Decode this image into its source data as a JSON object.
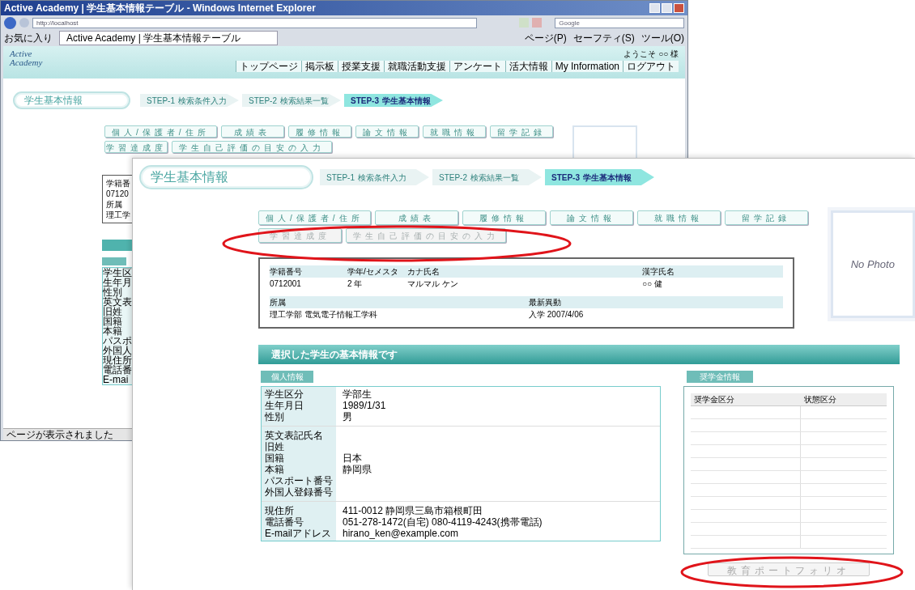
{
  "back_window": {
    "title": "Active Academy | 学生基本情報テーブル - Windows Internet Explorer",
    "address": "http://localhost",
    "search": "Google",
    "favorites": "お気に入り",
    "tab": "Active Academy | 学生基本情報テーブル",
    "toolbar": [
      "ページ(P)",
      "セーフティ(S)",
      "ツール(O)"
    ],
    "logo": "Active Academy",
    "welcome": "ようこそ ○○ 様",
    "nav": [
      "トップページ",
      "掲示板",
      "授業支援",
      "就職活動支援",
      "アンケート",
      "活大情報",
      "My Information",
      "ログアウト"
    ],
    "page_title": "学生基本情報",
    "steps": [
      {
        "step": "STEP-1",
        "label": "検索条件入力",
        "selected": false
      },
      {
        "step": "STEP-2",
        "label": "検索結果一覧",
        "selected": false
      },
      {
        "step": "STEP-3",
        "label": "学生基本情報",
        "selected": true
      }
    ],
    "tab_rows": [
      [
        {
          "label": "個人/保護者/住所",
          "disabled": false
        },
        {
          "label": "成績表",
          "disabled": false
        },
        {
          "label": "履修情報",
          "disabled": false
        },
        {
          "label": "論文情報",
          "disabled": false
        },
        {
          "label": "就職情報",
          "disabled": false
        },
        {
          "label": "留学記録",
          "disabled": false
        }
      ],
      [
        {
          "label": "学習達成度",
          "disabled": false
        },
        {
          "label": "学生自己評価の目安の入力",
          "disabled": false
        }
      ]
    ],
    "covered_texts": [
      "学籍番",
      "07120",
      "所属",
      "理工学"
    ],
    "covered_list": [
      "学生区",
      "生年月",
      "性別",
      "英文表",
      "旧姓",
      "国籍",
      "本籍",
      "パスポ",
      "外国人",
      "現住所",
      "電話番",
      "E-mai"
    ],
    "status": "ページが表示されました"
  },
  "front_panel": {
    "page_title": "学生基本情報",
    "steps": [
      {
        "step": "STEP-1",
        "label": "検索条件入力",
        "selected": false
      },
      {
        "step": "STEP-2",
        "label": "検索結果一覧",
        "selected": false
      },
      {
        "step": "STEP-3",
        "label": "学生基本情報",
        "selected": true
      }
    ],
    "tab_rows": [
      [
        {
          "label": "個人/保護者/住所",
          "disabled": false
        },
        {
          "label": "成績表",
          "disabled": false
        },
        {
          "label": "履修情報",
          "disabled": false
        },
        {
          "label": "論文情報",
          "disabled": false
        },
        {
          "label": "就職情報",
          "disabled": false
        },
        {
          "label": "留学記録",
          "disabled": false
        }
      ],
      [
        {
          "label": "学習達成度",
          "disabled": true
        },
        {
          "label": "学生自己評価の目安の入力",
          "disabled": true
        }
      ]
    ],
    "photo": "No Photo",
    "student": {
      "row1": [
        {
          "label": "学籍番号",
          "value": "0712001"
        },
        {
          "label": "学年/セメスタ",
          "value": "2 年"
        },
        {
          "label": "カナ氏名",
          "value": "マルマル ケン"
        },
        {
          "label": "漢字氏名",
          "value": "○○ 健"
        }
      ],
      "row2": [
        {
          "label": "所属",
          "value": "理工学部 電気電子情報工学科"
        },
        {
          "label": "最新異動",
          "value": "入学 2007/4/06"
        }
      ]
    },
    "banner": "選択した学生の基本情報です",
    "personal": {
      "heading": "個人情報",
      "groups": [
        [
          {
            "label": "学生区分",
            "value": "学部生"
          },
          {
            "label": "生年月日",
            "value": "1989/1/31"
          },
          {
            "label": "性別",
            "value": "男"
          }
        ],
        [
          {
            "label": "英文表記氏名"
          },
          {
            "label": "旧姓"
          },
          {
            "label": "国籍",
            "value": "日本"
          },
          {
            "label": "本籍",
            "value": "静岡県"
          },
          {
            "label": "パスポート番号"
          },
          {
            "label": "外国人登録番号"
          }
        ],
        [
          {
            "label": "現住所",
            "value": "411-0012 静岡県三島市箱根町田"
          },
          {
            "label": "電話番号",
            "value": "051-278-1472(自宅) 080-4119-4243(携帯電話)"
          },
          {
            "label": "E-mailアドレス",
            "value": "hirano_ken@example.com"
          }
        ]
      ]
    },
    "scholarship": {
      "heading": "奨学金情報",
      "columns": [
        "奨学金区分",
        "状態区分"
      ]
    },
    "portfolio_button": {
      "label": "教育ポートフォリオ",
      "disabled": true
    }
  }
}
